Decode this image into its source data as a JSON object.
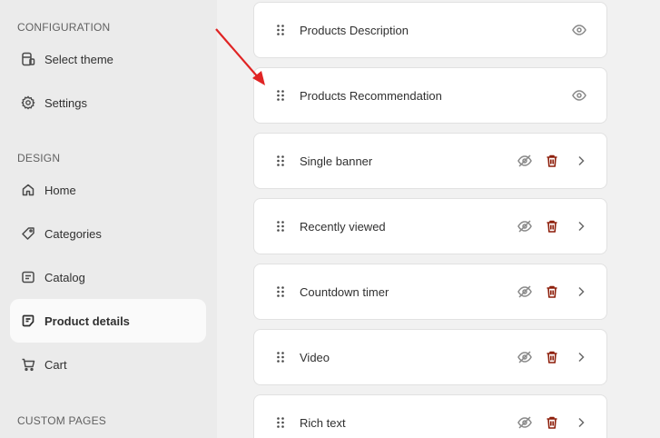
{
  "sidebar": {
    "configuration_title": "CONFIGURATION",
    "design_title": "DESIGN",
    "custom_pages_title": "CUSTOM PAGES",
    "config_items": [
      {
        "label": "Select theme",
        "icon": "theme-icon"
      },
      {
        "label": "Settings",
        "icon": "gear-icon"
      }
    ],
    "design_items": [
      {
        "label": "Home",
        "icon": "home-icon"
      },
      {
        "label": "Categories",
        "icon": "tag-icon"
      },
      {
        "label": "Catalog",
        "icon": "catalog-icon"
      },
      {
        "label": "Product details",
        "icon": "product-details-icon",
        "active": true
      },
      {
        "label": "Cart",
        "icon": "cart-icon"
      }
    ]
  },
  "sections": [
    {
      "title": "Products Description",
      "visible": true,
      "deletable": false
    },
    {
      "title": "Products Recommendation",
      "visible": true,
      "deletable": false
    },
    {
      "title": "Single banner",
      "visible": false,
      "deletable": true
    },
    {
      "title": "Recently viewed",
      "visible": false,
      "deletable": true
    },
    {
      "title": "Countdown timer",
      "visible": false,
      "deletable": true
    },
    {
      "title": "Video",
      "visible": false,
      "deletable": true
    },
    {
      "title": "Rich text",
      "visible": false,
      "deletable": true
    }
  ],
  "colors": {
    "trash": "#8e1f0b",
    "icon_gray": "#8a8a8a",
    "arrow": "#e02424"
  }
}
